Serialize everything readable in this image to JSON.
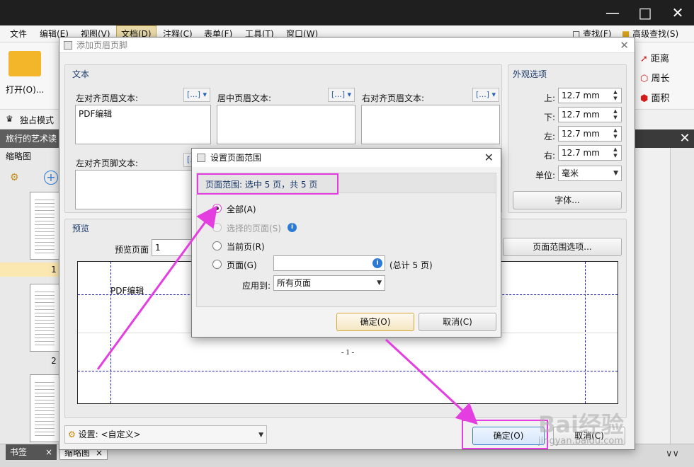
{
  "menu": {
    "items": [
      "文件",
      "编辑(E)",
      "视图(V)",
      "文档(D)",
      "注释(C)",
      "表单(F)",
      "工具(T)",
      "窗口(W)"
    ],
    "right": {
      "find": "查找(F)",
      "adv_find": "高级查找(S)"
    }
  },
  "ribbon": {
    "open": "打开(O)...",
    "distance": "距离",
    "perimeter": "周长",
    "area": "面积"
  },
  "exclusive_mode": "独占模式",
  "doc_tab": "旅行的艺术读",
  "thumb_panel": {
    "title": "缩略图",
    "page_numbers": [
      "1",
      "2"
    ]
  },
  "bottom_tabs": {
    "bookmarks": "书签",
    "thumbs": "缩略图"
  },
  "hf_dialog": {
    "title": "添加页眉页脚",
    "text_group": "文本",
    "left_header_label": "左对齐页眉文本:",
    "left_header_value": "PDF编辑",
    "center_header_label": "居中页眉文本:",
    "right_header_label": "右对齐页眉文本:",
    "left_footer_label": "左对齐页脚文本:",
    "insert_glyph": "[...]",
    "appearance_group": "外观选项",
    "margins": [
      {
        "label": "上:",
        "value": "12.7 mm"
      },
      {
        "label": "下:",
        "value": "12.7 mm"
      },
      {
        "label": "左:",
        "value": "12.7 mm"
      },
      {
        "label": "右:",
        "value": "12.7 mm"
      }
    ],
    "unit_label": "单位:",
    "unit_value": "毫米",
    "font_button": "字体...",
    "preview_group": "预览",
    "preview_page_label": "预览页面",
    "preview_page_value": "1",
    "page_range_button": "页面范围选项...",
    "preview_header_text": "PDF编辑",
    "preview_footer_text": "- 1 -",
    "settings_label": "设置:",
    "settings_value": "<自定义>",
    "ok": "确定(O)",
    "cancel": "取消(C)"
  },
  "page_range_dialog": {
    "title": "设置页面范围",
    "summary": "页面范围: 选中 5 页，共 5 页",
    "options": {
      "all": "全部(A)",
      "selected": "选择的页面(S)",
      "current": "当前页(R)",
      "pages": "页面(G)"
    },
    "pages_input_value": "",
    "total_label": "(总计 5 页)",
    "apply_to_label": "应用到:",
    "apply_to_value": "所有页面",
    "ok": "确定(O)",
    "cancel": "取消(C)"
  },
  "watermark": {
    "text": "Bai经验",
    "url": "jingyan.baidu.com"
  },
  "colors": {
    "annotation": "#e43ee0",
    "info_icon": "#2b7bd6",
    "titlebar": "#1f1f1f"
  },
  "icons": [
    "minimize-icon",
    "maximize-icon",
    "close-icon",
    "folder-open-icon",
    "info-icon",
    "chevron-down-icon",
    "gear-icon",
    "plus-icon"
  ]
}
